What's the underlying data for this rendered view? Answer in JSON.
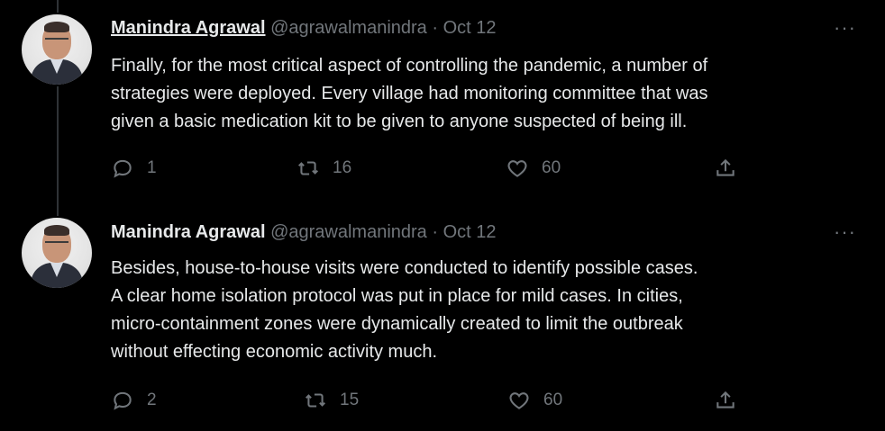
{
  "tweets": [
    {
      "name": "Manindra Agrawal",
      "handle": "@agrawalmanindra",
      "separator": "·",
      "date": "Oct 12",
      "more": "···",
      "lines": [
        "Finally, for the most critical aspect of controlling the pandemic, a number of",
        "strategies were deployed. Every village had monitoring committee that was",
        "given a basic medication kit to be given to anyone suspected of being ill."
      ],
      "replies": "1",
      "retweets": "16",
      "likes": "60"
    },
    {
      "name": "Manindra Agrawal",
      "handle": "@agrawalmanindra",
      "separator": "·",
      "date": "Oct 12",
      "more": "···",
      "lines": [
        "Besides, house-to-house visits were conducted to identify possible cases.",
        "A clear home isolation protocol was put in place for mild cases. In cities,",
        "micro-containment zones were dynamically created to limit the outbreak",
        "without effecting economic activity much."
      ],
      "replies": "2",
      "retweets": "15",
      "likes": "60"
    }
  ],
  "icons": {
    "reply": "reply-icon",
    "retweet": "retweet-icon",
    "like": "heart-icon",
    "share": "share-icon",
    "more": "more-icon"
  },
  "colors": {
    "background": "#000000",
    "text": "#e7e9ea",
    "muted": "#71767b",
    "thread_line": "#2f3336"
  }
}
